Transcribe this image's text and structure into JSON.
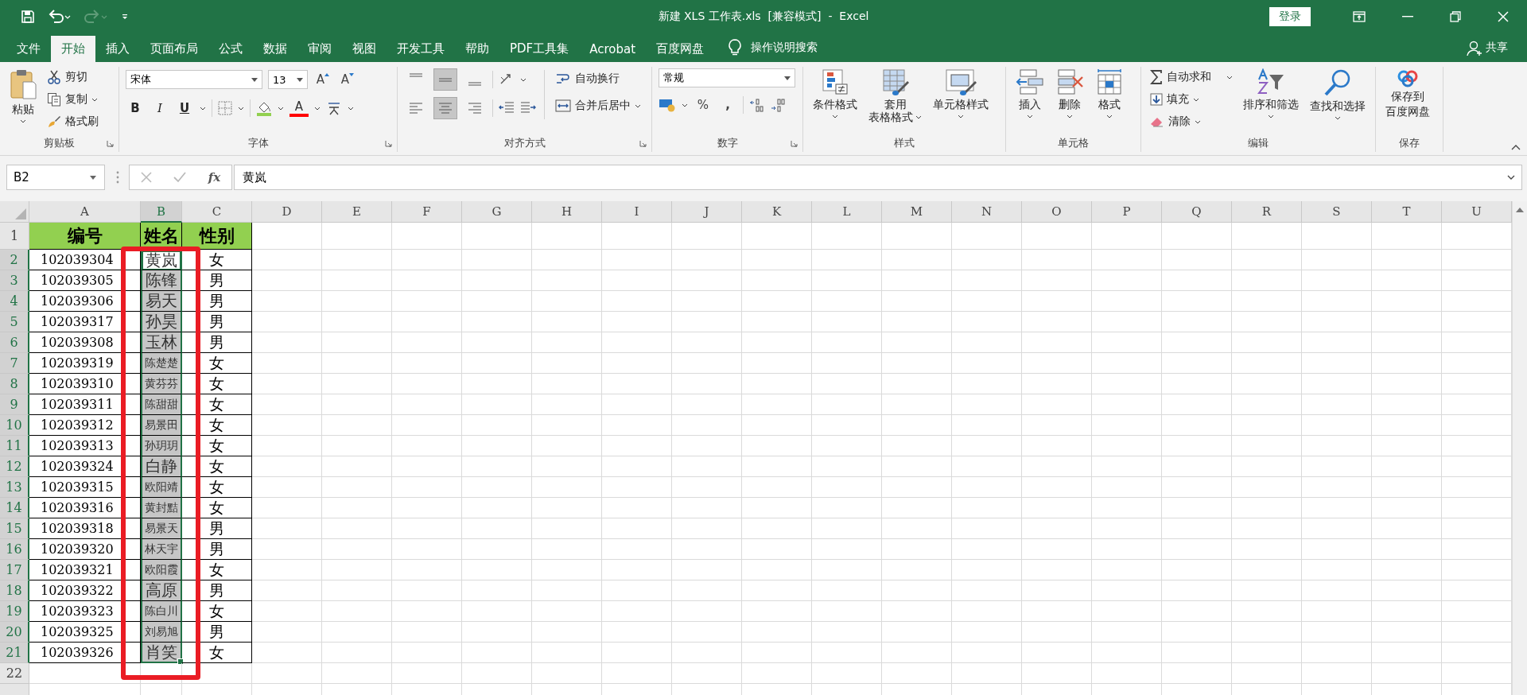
{
  "title_bar": {
    "title": "新建 XLS 工作表.xls  [兼容模式]  -  Excel",
    "sign_in": "登录"
  },
  "menu_tabs": [
    {
      "label": "文件",
      "selected": false
    },
    {
      "label": "开始",
      "selected": true
    },
    {
      "label": "插入",
      "selected": false
    },
    {
      "label": "页面布局",
      "selected": false
    },
    {
      "label": "公式",
      "selected": false
    },
    {
      "label": "数据",
      "selected": false
    },
    {
      "label": "审阅",
      "selected": false
    },
    {
      "label": "视图",
      "selected": false
    },
    {
      "label": "开发工具",
      "selected": false
    },
    {
      "label": "帮助",
      "selected": false
    },
    {
      "label": "PDF工具集",
      "selected": false
    },
    {
      "label": "Acrobat",
      "selected": false
    },
    {
      "label": "百度网盘",
      "selected": false
    }
  ],
  "tell_me": "操作说明搜索",
  "share": "共享",
  "ribbon": {
    "clipboard": {
      "label": "剪贴板",
      "paste": "粘贴",
      "cut": "剪切",
      "copy": "复制",
      "format_painter": "格式刷"
    },
    "font": {
      "label": "字体",
      "font_name": "宋体",
      "font_size": "13",
      "grow": "A",
      "shrink": "A",
      "bold": "B",
      "italic": "I",
      "underline": "U",
      "font_color": "A"
    },
    "alignment": {
      "label": "对齐方式",
      "wrap_text": "自动换行",
      "merge_center": "合并后居中",
      "align_buttons": [
        {
          "selected": false
        },
        {
          "selected": true
        },
        {
          "selected": false
        },
        {
          "selected": false
        },
        {
          "selected": true
        },
        {
          "selected": false
        }
      ]
    },
    "number": {
      "label": "数字",
      "format": "常规",
      "percent": "%",
      "comma": ","
    },
    "styles": {
      "label": "样式",
      "conditional": "条件格式",
      "table_lines": [
        "套用",
        "表格格式"
      ],
      "cell_styles": "单元格样式"
    },
    "cells": {
      "label": "单元格",
      "insert": "插入",
      "delete": "删除",
      "format": "格式"
    },
    "editing": {
      "label": "编辑",
      "autosum": "自动求和",
      "fill": "填充",
      "clear": "清除",
      "sort_filter": "排序和筛选",
      "find_select": "查找和选择"
    },
    "save": {
      "label": "保存",
      "lines": [
        "保存到",
        "百度网盘"
      ]
    }
  },
  "formula_bar": {
    "name_box": "B2",
    "fx": "fx",
    "content": "黄岚"
  },
  "sheet": {
    "columns": [
      {
        "label": "A",
        "selected": false
      },
      {
        "label": "B",
        "selected": true
      },
      {
        "label": "C",
        "selected": false
      },
      {
        "label": "D",
        "selected": false
      },
      {
        "label": "E",
        "selected": false
      },
      {
        "label": "F",
        "selected": false
      },
      {
        "label": "G",
        "selected": false
      },
      {
        "label": "H",
        "selected": false
      },
      {
        "label": "I",
        "selected": false
      },
      {
        "label": "J",
        "selected": false
      },
      {
        "label": "K",
        "selected": false
      },
      {
        "label": "L",
        "selected": false
      },
      {
        "label": "M",
        "selected": false
      },
      {
        "label": "N",
        "selected": false
      },
      {
        "label": "O",
        "selected": false
      },
      {
        "label": "P",
        "selected": false
      },
      {
        "label": "Q",
        "selected": false
      },
      {
        "label": "R",
        "selected": false
      },
      {
        "label": "S",
        "selected": false
      },
      {
        "label": "T",
        "selected": false
      },
      {
        "label": "U",
        "selected": false
      }
    ],
    "rows": [
      {
        "number": "1",
        "kind": "header",
        "selected": false,
        "active": false,
        "cells": [
          "编号",
          "姓名",
          "性别"
        ]
      },
      {
        "number": "2",
        "kind": "data",
        "selected": true,
        "active": true,
        "cells": [
          "102039304",
          "黄岚",
          "女"
        ]
      },
      {
        "number": "3",
        "kind": "data",
        "selected": true,
        "active": false,
        "cells": [
          "102039305",
          "陈锋",
          "男"
        ]
      },
      {
        "number": "4",
        "kind": "data",
        "selected": true,
        "active": false,
        "cells": [
          "102039306",
          "易天",
          "男"
        ]
      },
      {
        "number": "5",
        "kind": "data",
        "selected": true,
        "active": false,
        "cells": [
          "102039317",
          "孙昊",
          "男"
        ]
      },
      {
        "number": "6",
        "kind": "data",
        "selected": true,
        "active": false,
        "cells": [
          "102039308",
          "玉林",
          "男"
        ]
      },
      {
        "number": "7",
        "kind": "data",
        "selected": true,
        "active": false,
        "cells": [
          "102039319",
          "陈楚楚",
          "女"
        ]
      },
      {
        "number": "8",
        "kind": "data",
        "selected": true,
        "active": false,
        "cells": [
          "102039310",
          "黄芬芬",
          "女"
        ]
      },
      {
        "number": "9",
        "kind": "data",
        "selected": true,
        "active": false,
        "cells": [
          "102039311",
          "陈甜甜",
          "女"
        ]
      },
      {
        "number": "10",
        "kind": "data",
        "selected": true,
        "active": false,
        "cells": [
          "102039312",
          "易景田",
          "女"
        ]
      },
      {
        "number": "11",
        "kind": "data",
        "selected": true,
        "active": false,
        "cells": [
          "102039313",
          "孙玥玥",
          "女"
        ]
      },
      {
        "number": "12",
        "kind": "data",
        "selected": true,
        "active": false,
        "cells": [
          "102039324",
          "白静",
          "女"
        ]
      },
      {
        "number": "13",
        "kind": "data",
        "selected": true,
        "active": false,
        "cells": [
          "102039315",
          "欧阳靖",
          "女"
        ]
      },
      {
        "number": "14",
        "kind": "data",
        "selected": true,
        "active": false,
        "cells": [
          "102039316",
          "黄封黠",
          "女"
        ]
      },
      {
        "number": "15",
        "kind": "data",
        "selected": true,
        "active": false,
        "cells": [
          "102039318",
          "易景天",
          "男"
        ]
      },
      {
        "number": "16",
        "kind": "data",
        "selected": true,
        "active": false,
        "cells": [
          "102039320",
          "林天宇",
          "男"
        ]
      },
      {
        "number": "17",
        "kind": "data",
        "selected": true,
        "active": false,
        "cells": [
          "102039321",
          "欧阳霞",
          "女"
        ]
      },
      {
        "number": "18",
        "kind": "data",
        "selected": true,
        "active": false,
        "cells": [
          "102039322",
          "高原",
          "男"
        ]
      },
      {
        "number": "19",
        "kind": "data",
        "selected": true,
        "active": false,
        "cells": [
          "102039323",
          "陈白川",
          "女"
        ]
      },
      {
        "number": "20",
        "kind": "data",
        "selected": true,
        "active": false,
        "cells": [
          "102039325",
          "刘易旭",
          "男"
        ]
      },
      {
        "number": "21",
        "kind": "data",
        "selected": true,
        "active": false,
        "cells": [
          "102039326",
          "肖笑",
          "女"
        ]
      },
      {
        "number": "22",
        "kind": "empty",
        "selected": false,
        "active": false
      }
    ]
  }
}
